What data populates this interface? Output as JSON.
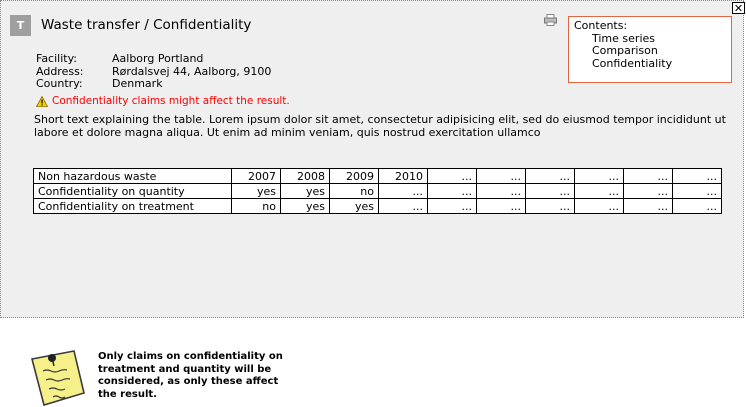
{
  "panel": {
    "badge": "T",
    "title": "Waste transfer / Confidentiality",
    "close_label": "✕",
    "print_icon": "print-icon"
  },
  "contents": {
    "heading": "Contents:",
    "items": [
      "Time series",
      "Comparison",
      "Confidentiality"
    ]
  },
  "facility": {
    "rows": [
      {
        "key": "Facility:",
        "value": "Aalborg Portland"
      },
      {
        "key": "Address:",
        "value": "Rørdalsvej 44, Aalborg, 9100"
      },
      {
        "key": "Country:",
        "value": "Denmark"
      }
    ]
  },
  "warning": {
    "icon": "warning-icon",
    "text": "Confidentiality claims might affect the result."
  },
  "description": "Short text explaining the table. Lorem ipsum dolor sit amet, consectetur adipisicing elit, sed do eiusmod tempor incididunt ut labore et dolore magna aliqua. Ut enim ad minim veniam, quis nostrud exercitation ullamco",
  "table": {
    "header": [
      "Non hazardous waste",
      "2007",
      "2008",
      "2009",
      "2010",
      "...",
      "...",
      "...",
      "...",
      "...",
      "..."
    ],
    "rows": [
      [
        "Confidentiality on quantity",
        "yes",
        "yes",
        "no",
        "...",
        "...",
        "...",
        "...",
        "...",
        "...",
        "..."
      ],
      [
        "Confidentiality on treatment",
        "no",
        "yes",
        "yes",
        "...",
        "...",
        "...",
        "...",
        "...",
        "...",
        "..."
      ]
    ]
  },
  "note": {
    "icon": "sticky-note-icon",
    "text": "Only claims on confidentiality on treatment and quantity will be considered, as only these affect the result."
  },
  "colors": {
    "panel_bg": "#efefef",
    "contents_border": "#e5663e",
    "warning_text": "#ff0000",
    "note_yellow": "#f5f08a"
  }
}
